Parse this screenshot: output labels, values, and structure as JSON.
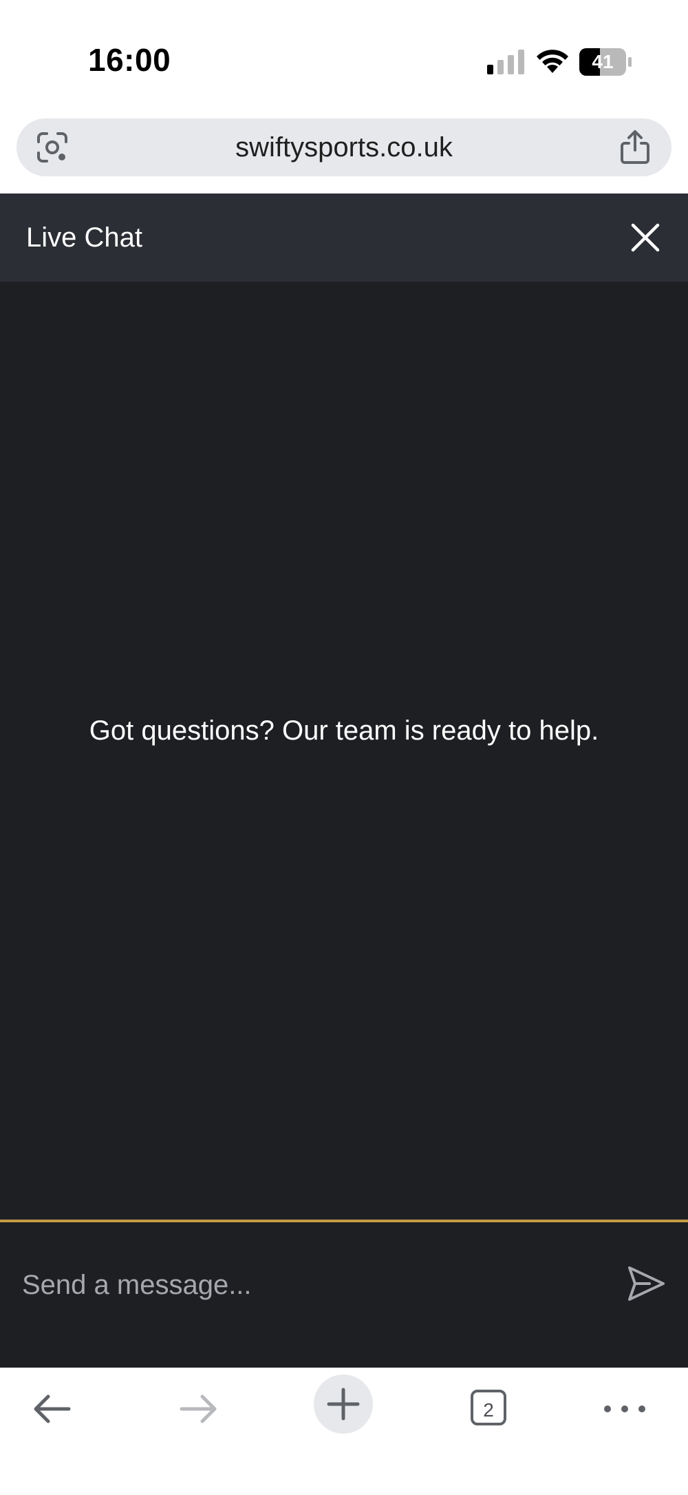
{
  "status_bar": {
    "time": "16:00",
    "battery_level": "41"
  },
  "browser": {
    "url": "swiftysports.co.uk"
  },
  "chat": {
    "title": "Live Chat",
    "empty_message": "Got questions? Our team is ready to help.",
    "input_placeholder": "Send a message...",
    "input_value": ""
  },
  "toolbar": {
    "tab_count": "2"
  },
  "icons": {
    "lens": "google-lens-icon",
    "share": "share-icon",
    "close": "close-icon",
    "send": "send-icon",
    "back": "back-arrow-icon",
    "forward": "forward-arrow-icon",
    "new_tab": "plus-icon",
    "tabs": "tabs-icon",
    "more": "more-dots-icon"
  },
  "colors": {
    "chat_header_bg": "#2c2e35",
    "chat_body_bg": "#1e1f23",
    "accent": "#c49a45",
    "url_bar_bg": "#e6e8eb"
  }
}
